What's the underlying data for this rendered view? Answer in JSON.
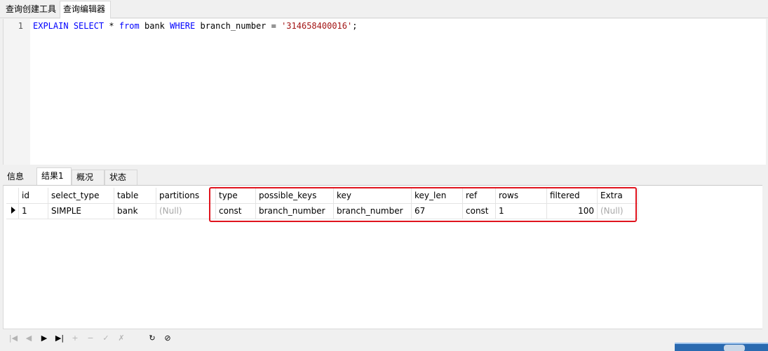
{
  "top_tabs": [
    "查询创建工具",
    "查询编辑器"
  ],
  "editor": {
    "line_number": "1",
    "code": {
      "explain": "EXPLAIN",
      "select": "SELECT",
      "star": " * ",
      "from": "from",
      "table": " bank ",
      "where": "WHERE",
      "cond": " branch_number = ",
      "value": "'314658400016'",
      "end": ";"
    }
  },
  "result_tabs": [
    "信息",
    "结果1",
    "概况",
    "状态"
  ],
  "grid": {
    "columns": [
      "id",
      "select_type",
      "table",
      "partitions",
      "type",
      "possible_keys",
      "key",
      "key_len",
      "ref",
      "rows",
      "filtered",
      "Extra"
    ],
    "row": [
      "1",
      "SIMPLE",
      "bank",
      "(Null)",
      "const",
      "branch_number",
      "branch_number",
      "67",
      "const",
      "1",
      "100",
      "(Null)"
    ]
  },
  "toolbar": {
    "first": "|◀",
    "prev": "◀",
    "next": "▶",
    "last": "▶|",
    "add": "+",
    "delete": "−",
    "apply": "✓",
    "cancel": "✗",
    "refresh": "↻",
    "stop": "⊘"
  },
  "colors": {
    "highlight": "#e0141e",
    "keyword": "#0000ff",
    "string": "#a31515"
  }
}
